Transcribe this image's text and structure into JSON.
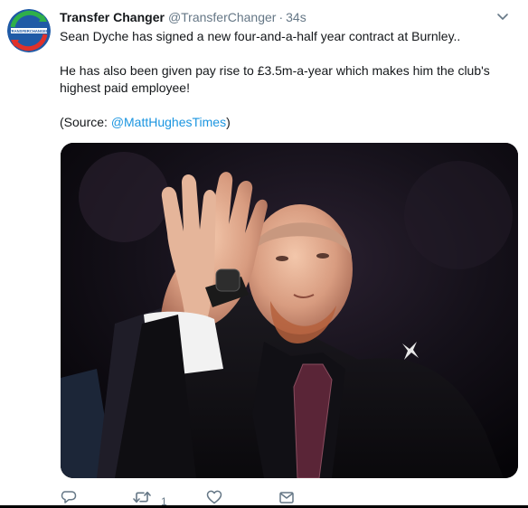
{
  "tweet": {
    "display_name": "Transfer Changer",
    "handle": "@TransferChanger",
    "separator": "·",
    "timestamp": "34s",
    "avatar_text": "TRANSFERCHANGER",
    "body": {
      "line1": "Sean Dyche has signed a new four-and-a-half year contract at Burnley..",
      "line2": "He has also been given pay rise to £3.5m-a-year which makes him the club's highest paid employee!",
      "source_prefix": "(Source: ",
      "source_mention": "@MattHughesTimes",
      "source_suffix": ")"
    },
    "actions": {
      "reply_icon": "reply-icon",
      "retweet_icon": "retweet-icon",
      "retweet_count": "1",
      "like_icon": "heart-icon",
      "dm_icon": "envelope-icon"
    }
  },
  "colors": {
    "name": "#14171a",
    "secondary": "#657786",
    "link": "#1b95e0",
    "icon": "#657786",
    "avatar_bg": "#1f5aa6",
    "avatar_ring_green": "#2fb04a",
    "avatar_ring_red": "#e0312a"
  }
}
